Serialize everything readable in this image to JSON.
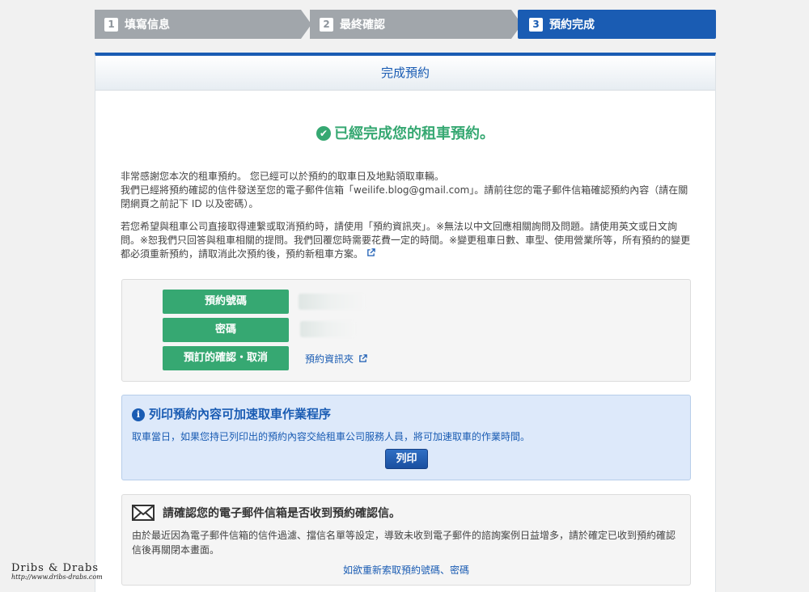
{
  "steps": [
    {
      "num": "1",
      "label": "填寫信息"
    },
    {
      "num": "2",
      "label": "最終確認"
    },
    {
      "num": "3",
      "label": "預約完成"
    }
  ],
  "panel": {
    "header": "完成預約",
    "done_title": "已經完成您的租車預約。",
    "para1_line1": "非常感謝您本次的租車預約。 您已經可以於預約的取車日及地點領取車輛。",
    "para1_line2": "我們已經將預約確認的信件發送至您的電子郵件信箱「weilife.blog@gmail.com」。請前往您的電子郵件信箱確認預約內容（請在關閉網頁之前記下 ID 以及密碼）。",
    "para2": "若您希望與租車公司直接取得連繫或取消預約時，請使用「預約資訊夾」。※無法以中文回應相關詢問及問題。請使用英文或日文詢問。※恕我們只回答與租車相關的提問。我們回覆您時需要花費一定的時間。※變更租車日數、車型、使用營業所等，所有預約的變更都必須重新預約，請取消此次預約後，預約新租車方案。"
  },
  "infobox": {
    "booking_number_label": "預約號碼",
    "password_label": "密碼",
    "confirm_cancel_label": "預訂的確認・取消",
    "folder_link": "預約資訊夾"
  },
  "printbox": {
    "title": "列印預約內容可加速取車作業程序",
    "body": "取車當日，如果您持已列印出的預約內容交給租車公司服務人員，將可加速取車的作業時間。",
    "button": "列印"
  },
  "mailbox": {
    "title": "請確認您的電子郵件信箱是否收到預約確認信。",
    "body": "由於最近因為電子郵件信箱的信件過濾、擋信名單等設定，導致未收到電子郵件的諮詢案例日益增多，請於確定已收到預約確認信後再關閉本畫面。",
    "link": "如欲重新索取預約號碼、密碼"
  },
  "watermark": {
    "line1": "Dribs & Drabs",
    "line2": "http://www.dribs-drabs.com"
  },
  "colors": {
    "accent": "#1a5cb3",
    "success": "#36a872",
    "step_inactive": "#a1a6ab"
  },
  "icons": [
    "check-circle-icon",
    "external-link-icon",
    "info-icon",
    "envelope-icon"
  ]
}
